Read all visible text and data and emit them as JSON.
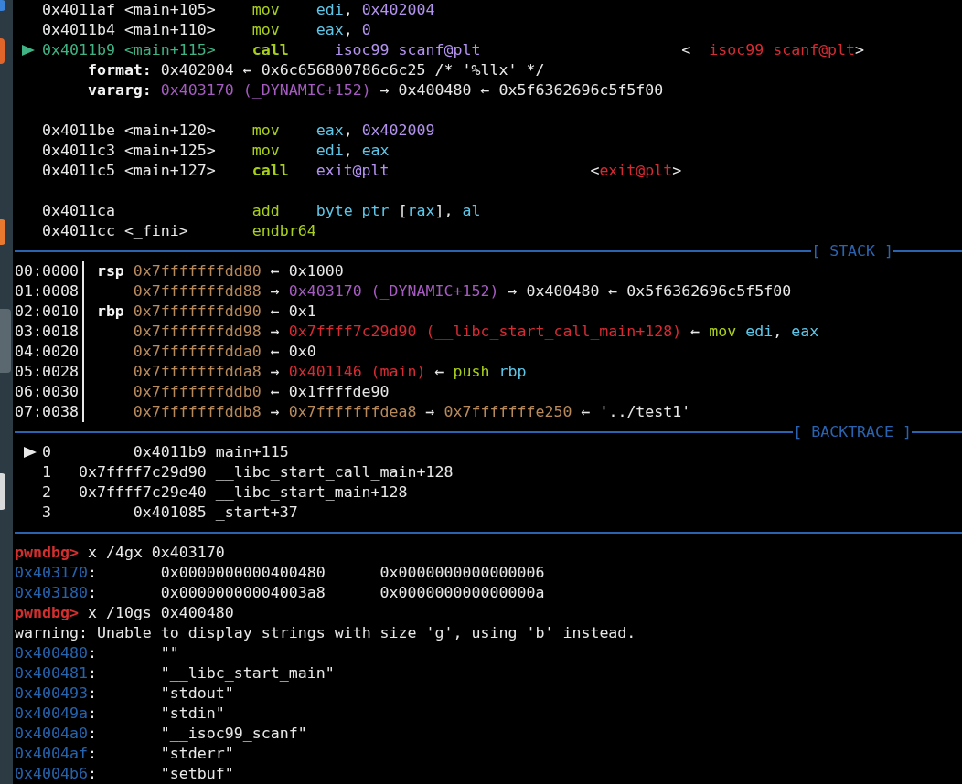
{
  "disassembly": [
    {
      "kind": "insn",
      "current": false,
      "addr": "0x4011af <main+105>",
      "op": {
        "kind": "op",
        "text": "mov"
      },
      "operands": [
        {
          "kind": "reg",
          "text": "edi"
        },
        {
          "kind": "plain",
          "text": ", "
        },
        {
          "kind": "imm",
          "text": "0x402004"
        }
      ]
    },
    {
      "kind": "insn",
      "current": false,
      "addr": "0x4011b4 <main+110>",
      "op": {
        "kind": "op",
        "text": "mov"
      },
      "operands": [
        {
          "kind": "reg",
          "text": "eax"
        },
        {
          "kind": "plain",
          "text": ", "
        },
        {
          "kind": "imm",
          "text": "0"
        }
      ]
    },
    {
      "kind": "insn",
      "current": true,
      "addr": "0x4011b9 <main+115>",
      "op": {
        "kind": "opb",
        "text": "call"
      },
      "operands": [
        {
          "kind": "imm",
          "text": "__isoc99_scanf@plt"
        }
      ],
      "note": [
        {
          "kind": "plain",
          "text": "<"
        },
        {
          "kind": "code",
          "text": "__isoc99_scanf@plt"
        },
        {
          "kind": "plain",
          "text": ">"
        }
      ]
    },
    {
      "kind": "arg",
      "segments": [
        {
          "kind": "bold",
          "text": "format:"
        },
        {
          "kind": "plain",
          "text": " 0x402004 ← 0x6c656800786c6c25 /* '%llx' */"
        }
      ]
    },
    {
      "kind": "arg",
      "segments": [
        {
          "kind": "bold",
          "text": "vararg:"
        },
        {
          "kind": "data",
          "text": " 0x403170 (_DYNAMIC+152)"
        },
        {
          "kind": "plain",
          "text": " → 0x400480 ← 0x5f6362696c5f5f00"
        }
      ]
    },
    {
      "kind": "blank"
    },
    {
      "kind": "insn",
      "current": false,
      "addr": "0x4011be <main+120>",
      "op": {
        "kind": "op",
        "text": "mov"
      },
      "operands": [
        {
          "kind": "reg",
          "text": "eax"
        },
        {
          "kind": "plain",
          "text": ", "
        },
        {
          "kind": "imm",
          "text": "0x402009"
        }
      ]
    },
    {
      "kind": "insn",
      "current": false,
      "addr": "0x4011c3 <main+125>",
      "op": {
        "kind": "op",
        "text": "mov"
      },
      "operands": [
        {
          "kind": "reg",
          "text": "edi"
        },
        {
          "kind": "plain",
          "text": ", "
        },
        {
          "kind": "reg",
          "text": "eax"
        }
      ]
    },
    {
      "kind": "insn",
      "current": false,
      "addr": "0x4011c5 <main+127>",
      "op": {
        "kind": "opb",
        "text": "call"
      },
      "operands": [
        {
          "kind": "imm",
          "text": "exit@plt"
        }
      ],
      "note": [
        {
          "kind": "plain",
          "text": "<"
        },
        {
          "kind": "code",
          "text": "exit@plt"
        },
        {
          "kind": "plain",
          "text": ">"
        }
      ]
    },
    {
      "kind": "blank"
    },
    {
      "kind": "insn",
      "current": false,
      "addr": "0x4011ca",
      "op": {
        "kind": "op",
        "text": "add"
      },
      "operands": [
        {
          "kind": "reg",
          "text": "byte ptr"
        },
        {
          "kind": "plain",
          "text": " ["
        },
        {
          "kind": "reg",
          "text": "rax"
        },
        {
          "kind": "plain",
          "text": "], "
        },
        {
          "kind": "reg",
          "text": "al"
        }
      ]
    },
    {
      "kind": "insn",
      "current": false,
      "addr": "0x4011cc <_fini>",
      "op": {
        "kind": "op",
        "text": "endbr64"
      }
    }
  ],
  "stack_title": "[ STACK ]",
  "stack": [
    {
      "offset": "00:0000",
      "reg": "rsp",
      "segments": [
        {
          "kind": "stack",
          "text": "0x7fffffffdd80"
        },
        {
          "kind": "plain",
          "text": " ← 0x1000"
        }
      ]
    },
    {
      "offset": "01:0008",
      "segments": [
        {
          "kind": "stack",
          "text": "0x7fffffffdd88"
        },
        {
          "kind": "plain",
          "text": " → "
        },
        {
          "kind": "data",
          "text": "0x403170 (_DYNAMIC+152)"
        },
        {
          "kind": "plain",
          "text": " → 0x400480 ← 0x5f6362696c5f5f00"
        }
      ]
    },
    {
      "offset": "02:0010",
      "reg": "rbp",
      "segments": [
        {
          "kind": "stack",
          "text": "0x7fffffffdd90"
        },
        {
          "kind": "plain",
          "text": " ← 0x1"
        }
      ]
    },
    {
      "offset": "03:0018",
      "segments": [
        {
          "kind": "stack",
          "text": "0x7fffffffdd98"
        },
        {
          "kind": "plain",
          "text": " → "
        },
        {
          "kind": "code",
          "text": "0x7ffff7c29d90 (__libc_start_call_main+128)"
        },
        {
          "kind": "plain",
          "text": " ← "
        },
        {
          "kind": "op",
          "text": "mov"
        },
        {
          "kind": "reg",
          "text": " edi"
        },
        {
          "kind": "plain",
          "text": ","
        },
        {
          "kind": "reg",
          "text": " eax"
        }
      ]
    },
    {
      "offset": "04:0020",
      "segments": [
        {
          "kind": "stack",
          "text": "0x7fffffffdda0"
        },
        {
          "kind": "plain",
          "text": " ← 0x0"
        }
      ]
    },
    {
      "offset": "05:0028",
      "segments": [
        {
          "kind": "stack",
          "text": "0x7fffffffdda8"
        },
        {
          "kind": "plain",
          "text": " → "
        },
        {
          "kind": "code",
          "text": "0x401146 (main)"
        },
        {
          "kind": "plain",
          "text": " ← "
        },
        {
          "kind": "op",
          "text": "push"
        },
        {
          "kind": "reg",
          "text": " rbp"
        }
      ]
    },
    {
      "offset": "06:0030",
      "segments": [
        {
          "kind": "stack",
          "text": "0x7fffffffddb0"
        },
        {
          "kind": "plain",
          "text": " ← 0x1ffffde90"
        }
      ]
    },
    {
      "offset": "07:0038",
      "segments": [
        {
          "kind": "stack",
          "text": "0x7fffffffddb8"
        },
        {
          "kind": "plain",
          "text": " → "
        },
        {
          "kind": "stack",
          "text": "0x7fffffffdea8"
        },
        {
          "kind": "plain",
          "text": " → "
        },
        {
          "kind": "stack",
          "text": "0x7fffffffe250"
        },
        {
          "kind": "plain",
          "text": " ← '../test1'"
        }
      ]
    }
  ],
  "backtrace_title": "[ BACKTRACE ]",
  "backtrace": [
    {
      "selected": true,
      "num": "0",
      "addr": "0x4011b9",
      "sym": "main+115"
    },
    {
      "selected": false,
      "num": "1",
      "addr": "0x7ffff7c29d90",
      "sym": "__libc_start_call_main+128"
    },
    {
      "selected": false,
      "num": "2",
      "addr": "0x7ffff7c29e40",
      "sym": "__libc_start_main+128"
    },
    {
      "selected": false,
      "num": "3",
      "addr": "0x401085",
      "sym": "_start+37"
    }
  ],
  "console": [
    {
      "kind": "cmd",
      "prompt": "pwndbg>",
      "command": "x /4gx 0x403170"
    },
    {
      "kind": "mem",
      "addr": "0x403170:",
      "values": [
        "0x0000000000400480",
        "0x0000000000000006"
      ]
    },
    {
      "kind": "mem",
      "addr": "0x403180:",
      "values": [
        "0x00000000004003a8",
        "0x000000000000000a"
      ]
    },
    {
      "kind": "cmd",
      "prompt": "pwndbg>",
      "command": "x /10gs 0x400480"
    },
    {
      "kind": "text",
      "text": "warning: Unable to display strings with size 'g', using 'b' instead."
    },
    {
      "kind": "mem",
      "addr": "0x400480:",
      "values": [
        "\"\""
      ]
    },
    {
      "kind": "mem",
      "addr": "0x400481:",
      "values": [
        "\"__libc_start_main\""
      ]
    },
    {
      "kind": "mem",
      "addr": "0x400493:",
      "values": [
        "\"stdout\""
      ]
    },
    {
      "kind": "mem",
      "addr": "0x40049a:",
      "values": [
        "\"stdin\""
      ]
    },
    {
      "kind": "mem",
      "addr": "0x4004a0:",
      "values": [
        "\"__isoc99_scanf\""
      ]
    },
    {
      "kind": "mem",
      "addr": "0x4004af:",
      "values": [
        "\"stderr\""
      ]
    },
    {
      "kind": "mem",
      "addr": "0x4004b6:",
      "values": [
        "\"setbuf\""
      ]
    }
  ]
}
